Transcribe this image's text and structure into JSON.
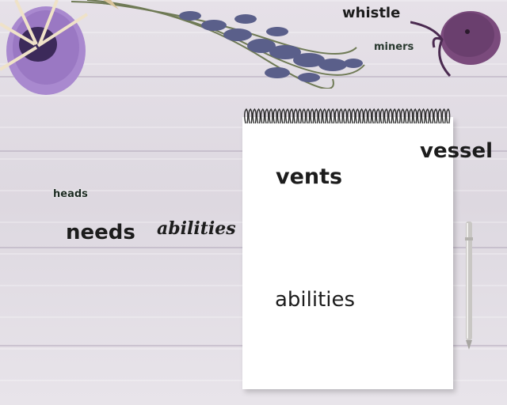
{
  "words": {
    "whistle": "whistle",
    "miners": "miners",
    "vessel": "vessel",
    "vents": "vents",
    "heads": "heads",
    "needs": "needs",
    "abilities_script": "abilities",
    "abilities_notebook": "abilities"
  },
  "colors": {
    "text": "#1c1c1c",
    "notebook": "#ffffff",
    "lavender": "#5a5f8a",
    "candle": "#6a3f6e",
    "jar": "#a084c8"
  }
}
